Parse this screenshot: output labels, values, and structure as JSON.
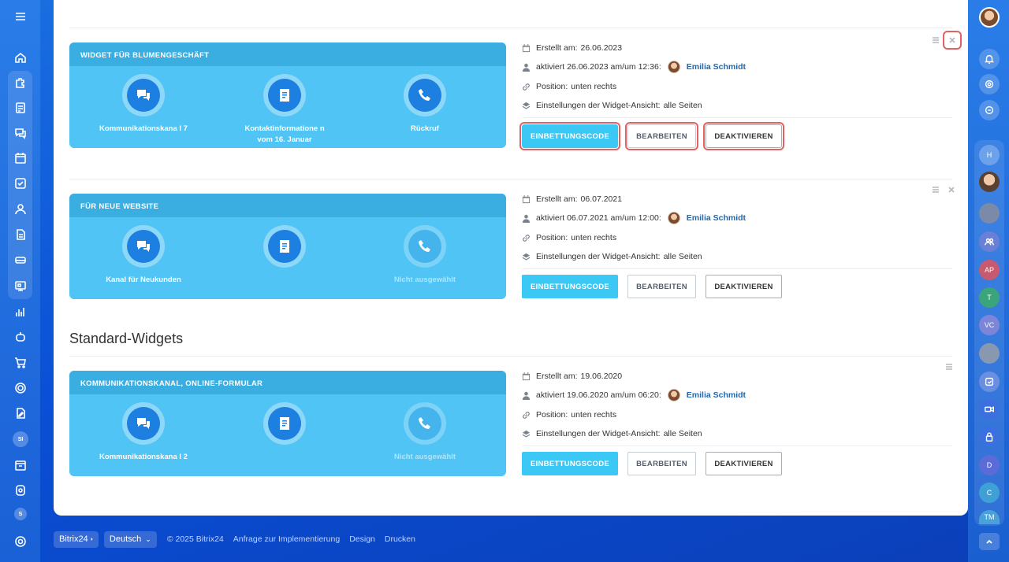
{
  "left_sidebar": {
    "avatar_si": "SI",
    "avatar_s": "S"
  },
  "right_sidebar": {
    "avatars": [
      "H",
      "AP",
      "T",
      "VC",
      "D",
      "C",
      "TM"
    ]
  },
  "widgets": [
    {
      "title": "WIDGET FÜR BLUMENGESCHÄFT",
      "features": [
        {
          "label": "Kommunikationskana l 7",
          "active": true
        },
        {
          "label": "Kontaktinformatione n vom 16. Januar",
          "active": true
        },
        {
          "label": "Rückruf",
          "active": true
        }
      ],
      "created_label": "Erstellt am:",
      "created": "26.06.2023",
      "activated_label": "aktiviert 26.06.2023 am/um 12:36:",
      "user": "Emilia Schmidt",
      "position_label": "Position:",
      "position": "unten rechts",
      "settings_label": "Einstellungen der Widget-Ansicht:",
      "settings": "alle Seiten"
    },
    {
      "title": "FÜR NEUE WEBSITE",
      "features": [
        {
          "label": "Kanal für Neukunden",
          "active": true
        },
        {
          "label": "",
          "active": true
        },
        {
          "label": "Nicht ausgewählt",
          "active": false
        }
      ],
      "created_label": "Erstellt am:",
      "created": "06.07.2021",
      "activated_label": "aktiviert 06.07.2021 am/um 12:00:",
      "user": "Emilia Schmidt",
      "position_label": "Position:",
      "position": "unten rechts",
      "settings_label": "Einstellungen der Widget-Ansicht:",
      "settings": "alle Seiten"
    },
    {
      "title": "KOMMUNIKATIONSKANAL, ONLINE-FORMULAR",
      "features": [
        {
          "label": "Kommunikationskana l 2",
          "active": true
        },
        {
          "label": "",
          "active": true
        },
        {
          "label": "Nicht ausgewählt",
          "active": false
        }
      ],
      "created_label": "Erstellt am:",
      "created": "19.06.2020",
      "activated_label": "aktiviert 19.06.2020 am/um 06:20:",
      "user": "Emilia Schmidt",
      "position_label": "Position:",
      "position": "unten rechts",
      "settings_label": "Einstellungen der Widget-Ansicht:",
      "settings": "alle Seiten"
    }
  ],
  "buttons": {
    "embed": "EINBETTUNGSCODE",
    "edit": "BEARBEITEN",
    "deactivate": "DEAKTIVIEREN"
  },
  "section_title": "Standard-Widgets",
  "footer": {
    "brand": "Bitrix24",
    "language": "Deutsch",
    "copyright": "© 2025 Bitrix24",
    "links": [
      "Anfrage zur Implementierung",
      "Design",
      "Drucken"
    ]
  },
  "colors": {
    "widget_bg": "#50c4f5",
    "widget_header": "#3aaee0",
    "primary_button": "#3bc8f5",
    "highlight": "#e26262"
  }
}
